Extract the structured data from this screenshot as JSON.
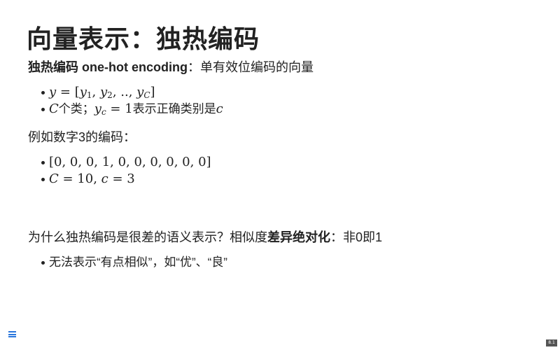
{
  "title": "向量表示：独热编码",
  "definition": {
    "term": "独热编码 one-hot encoding",
    "rest": "：单有效位编码的向量"
  },
  "bullets1": {
    "b1": {
      "y": "y",
      "eq": " = [",
      "y1": "y",
      "s1": "1",
      "c1": ", ",
      "y2": "y",
      "s2": "2",
      "mid": ", .., ",
      "yC": "y",
      "sC": "C",
      "end": "]"
    },
    "b2": {
      "C": "C",
      "t1": "个类；",
      "yc": "y",
      "sc": "c",
      "eq": " = 1",
      "t2": "表示正确类别是",
      "c": "c"
    }
  },
  "example_heading": "例如数字3的编码：",
  "bullets2": {
    "vector": "[0, 0, 0, 1, 0, 0, 0, 0, 0, 0]",
    "C": "C",
    "eq1": " = 10, ",
    "c": "c",
    "eq2": " = 3"
  },
  "question": {
    "prefix": "为什么独热编码是很差的语义表示？相似度",
    "bold": "差异绝对化",
    "suffix": "：非0即1"
  },
  "bullets3": {
    "b1": "无法表示“有点相似”，如“优”、“良”"
  },
  "page_number": "8.1"
}
